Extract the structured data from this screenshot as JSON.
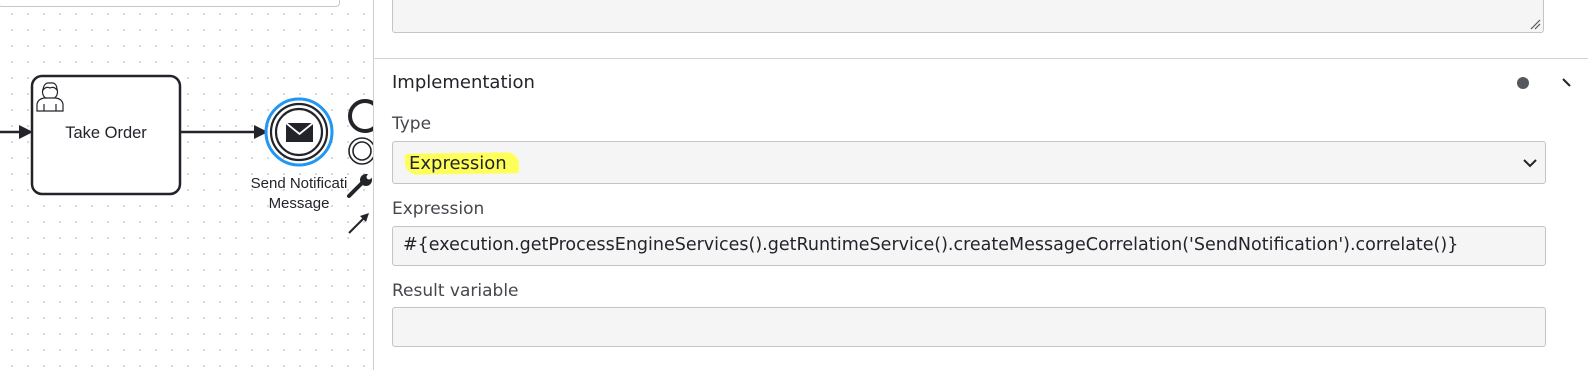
{
  "diagram": {
    "task": {
      "label": "Take Order",
      "icon": "user-icon"
    },
    "event": {
      "label": "Send Notificati\nMessage",
      "icon": "envelope-icon"
    },
    "palette_icons": [
      "end-event-icon",
      "intermediate-event-icon",
      "wrench-icon",
      "connect-arrow-icon"
    ]
  },
  "panel": {
    "group": {
      "title": "Implementation"
    },
    "type": {
      "label": "Type",
      "value": "Expression"
    },
    "expression": {
      "label": "Expression",
      "value": "#{execution.getProcessEngineServices().getRuntimeService().createMessageCorrelation('SendNotification').correlate()}"
    },
    "result_variable": {
      "label": "Result variable",
      "value": ""
    }
  },
  "colors": {
    "selection_blue": "#2196f3",
    "highlight_yellow": "#ffff5a",
    "field_background": "#f5f5f5"
  }
}
